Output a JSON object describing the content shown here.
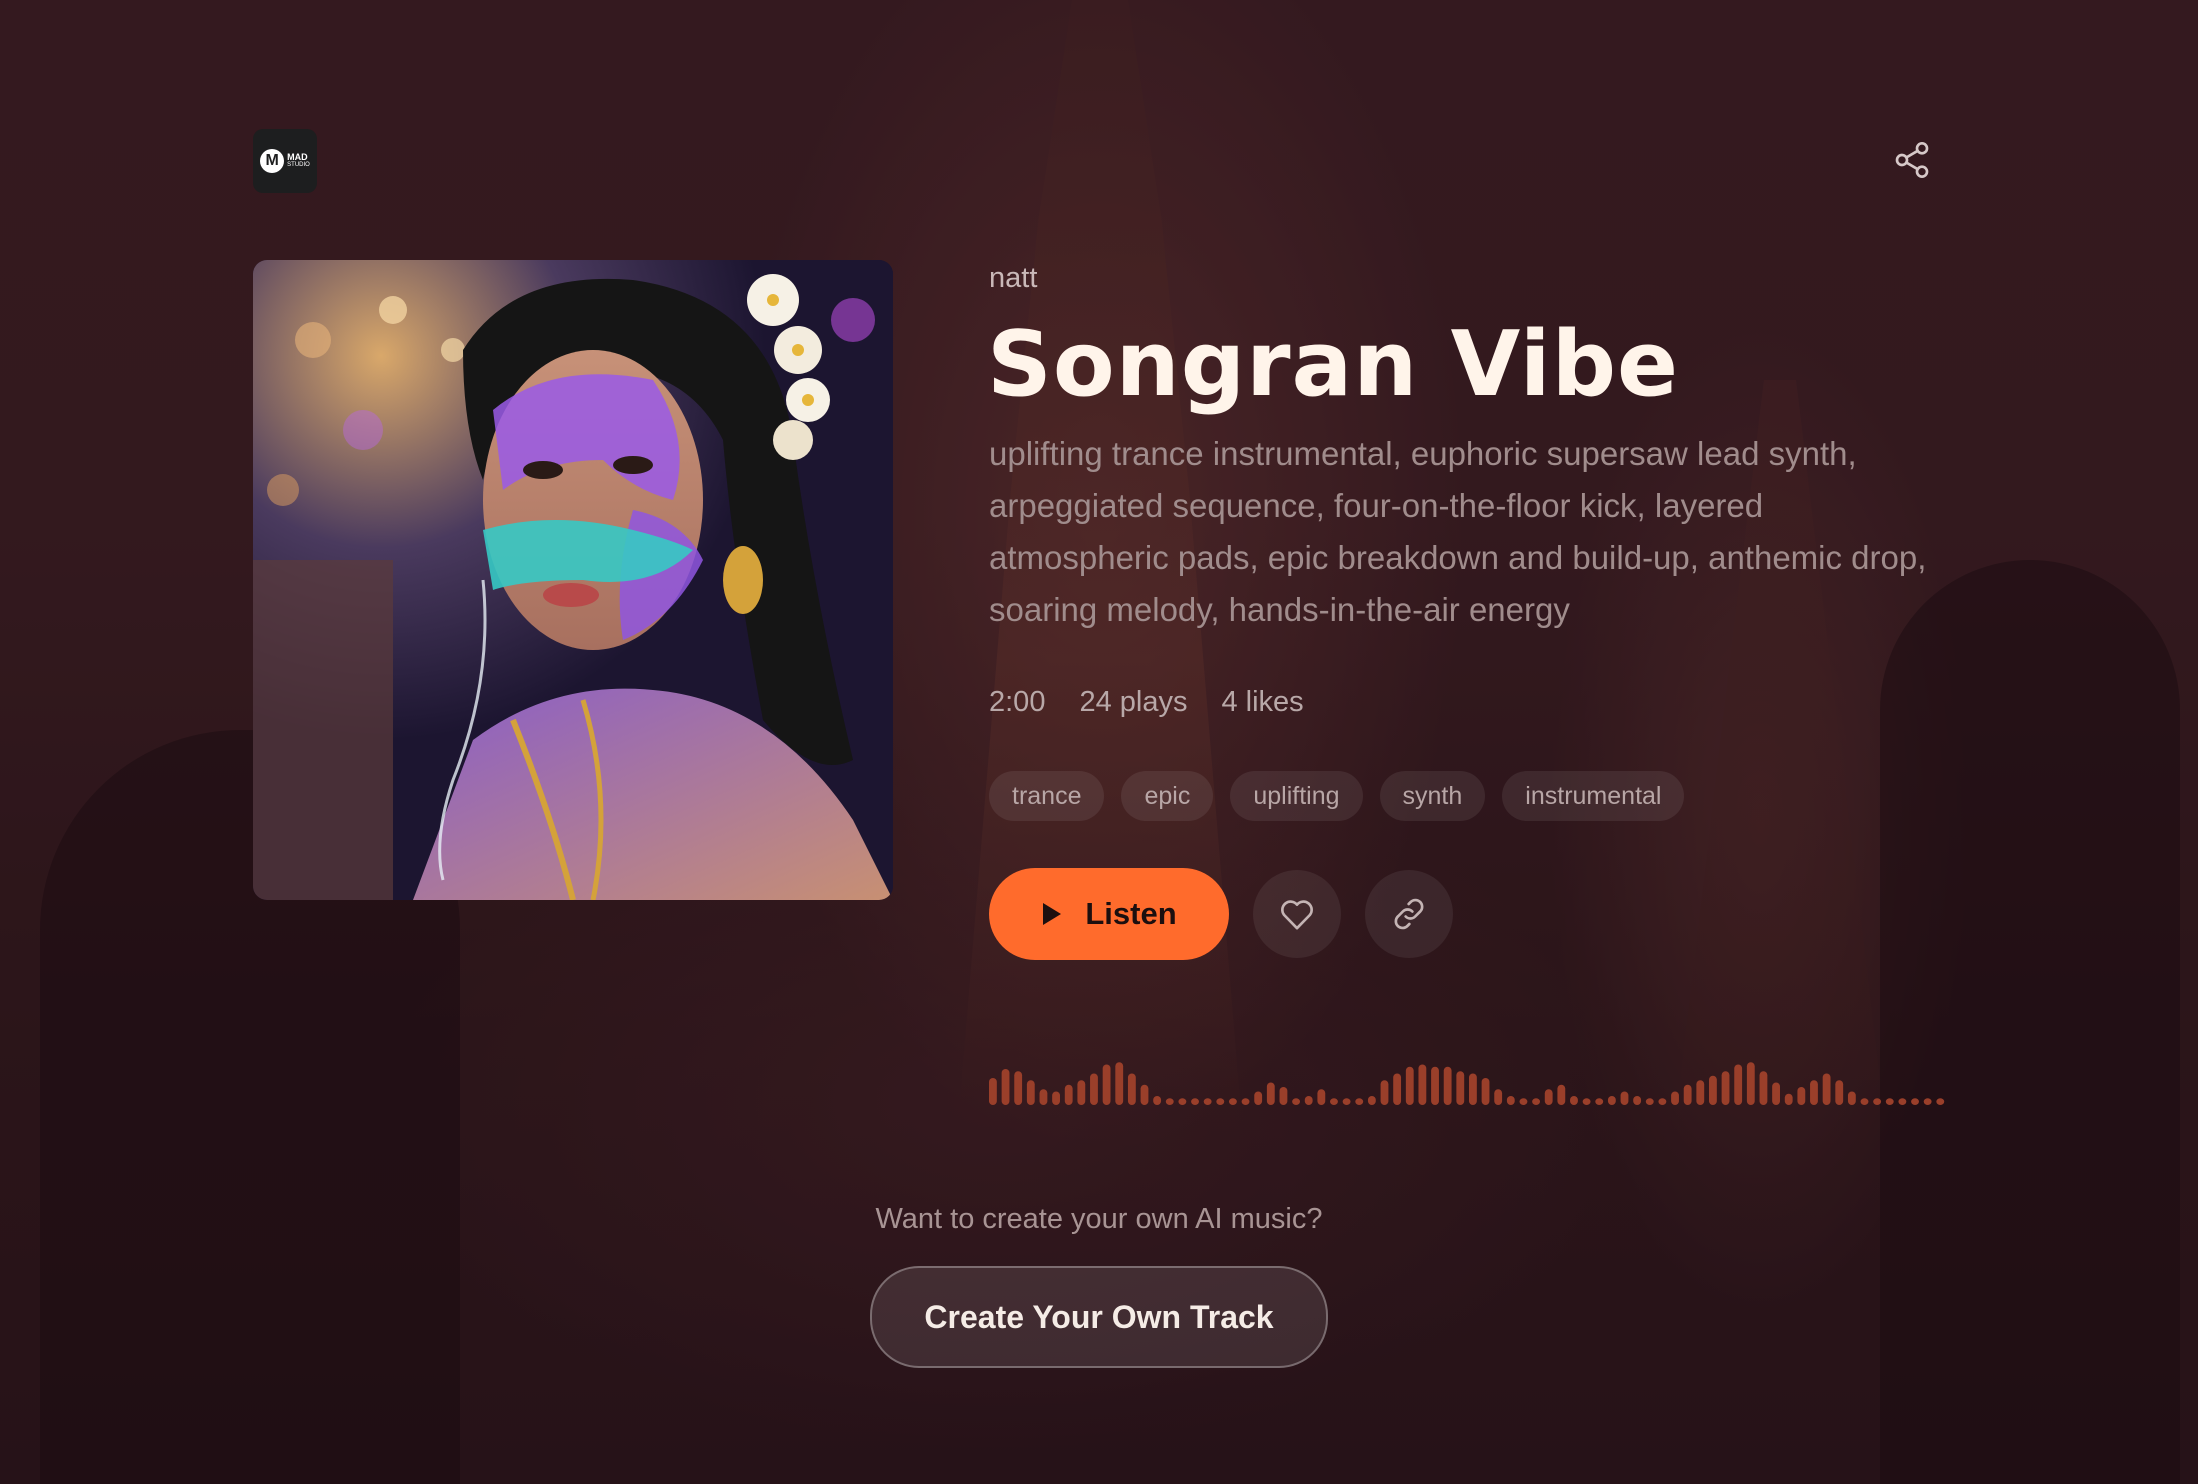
{
  "header": {
    "logo": {
      "mark": "M",
      "line1": "MAD",
      "line2": "STUDIO"
    },
    "share_icon": "share-icon"
  },
  "track": {
    "artist": "natt",
    "title": "Songran Vibe",
    "description": "uplifting trance instrumental, euphoric supersaw lead synth, arpeggiated sequence, four-on-the-floor kick, layered atmospheric pads, epic breakdown and build-up, anthemic drop, soaring melody, hands-in-the-air energy",
    "duration": "2:00",
    "plays": "24 plays",
    "likes": "4 likes",
    "tags": [
      "trance",
      "epic",
      "uplifting",
      "synth",
      "instrumental"
    ]
  },
  "actions": {
    "listen_label": "Listen",
    "listen_icon": "play-icon",
    "like_icon": "heart-icon",
    "copy_link_icon": "link-icon"
  },
  "waveform": {
    "color": "#9a3f2a",
    "levels": [
      0.6,
      0.8,
      0.75,
      0.55,
      0.35,
      0.3,
      0.45,
      0.55,
      0.7,
      0.9,
      0.95,
      0.7,
      0.45,
      0.2,
      0.15,
      0.15,
      0.15,
      0.15,
      0.15,
      0.15,
      0.15,
      0.3,
      0.5,
      0.4,
      0.15,
      0.2,
      0.35,
      0.15,
      0.15,
      0.15,
      0.2,
      0.55,
      0.7,
      0.85,
      0.9,
      0.85,
      0.85,
      0.75,
      0.7,
      0.6,
      0.35,
      0.2,
      0.15,
      0.15,
      0.35,
      0.45,
      0.2,
      0.15,
      0.15,
      0.2,
      0.3,
      0.2,
      0.15,
      0.15,
      0.3,
      0.45,
      0.55,
      0.65,
      0.75,
      0.9,
      0.95,
      0.75,
      0.5,
      0.25,
      0.4,
      0.55,
      0.7,
      0.55,
      0.3,
      0.15,
      0.15,
      0.15,
      0.15,
      0.15,
      0.15,
      0.15
    ]
  },
  "footer": {
    "prompt": "Want to create your own AI music?",
    "cta_label": "Create Your Own Track"
  },
  "colors": {
    "accent": "#ff6b2c",
    "background": "#2a1519"
  }
}
